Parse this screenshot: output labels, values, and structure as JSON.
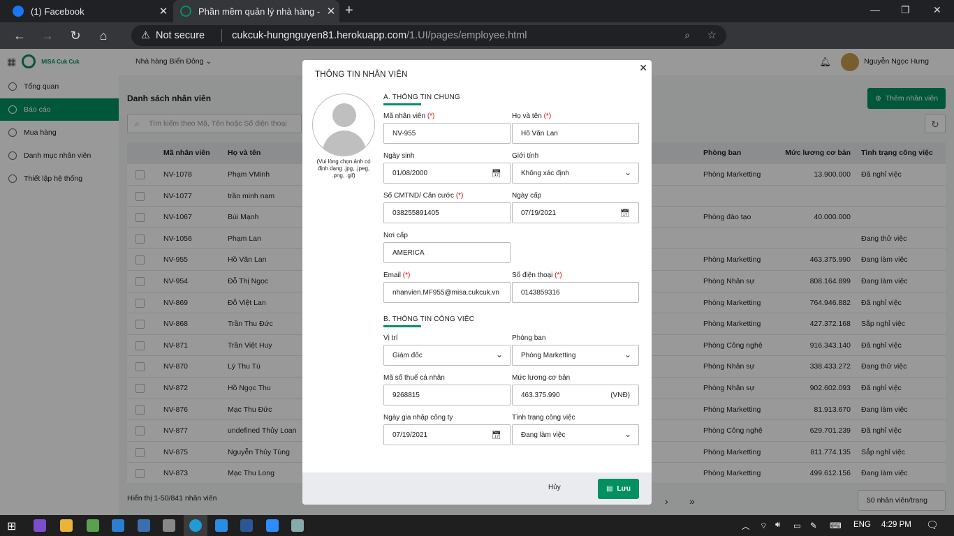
{
  "browser": {
    "tabs": [
      {
        "title": "(1) Facebook",
        "color": "#1877f2"
      },
      {
        "title": "Phần mềm quản lý nhà hàng - C",
        "color": "#019160"
      }
    ],
    "security": "Not secure",
    "url_host": "cukcuk-hungnguyen81.herokuapp.com",
    "url_path": "/1.UI/pages/employee.html"
  },
  "sidebar": {
    "logo_text": "MISA Cuk Cuk",
    "items": [
      {
        "label": "Tổng quan"
      },
      {
        "label": "Báo cáo"
      },
      {
        "label": "Mua hàng"
      },
      {
        "label": "Danh mục nhân viên"
      },
      {
        "label": "Thiết lập hệ thống"
      }
    ]
  },
  "header": {
    "store": "Nhà hàng Biển Đông",
    "user": "Nguyễn Ngọc Hưng"
  },
  "page": {
    "title": "Danh sách nhân viên",
    "add_button": "Thêm nhân viên",
    "search_placeholder": "Tìm kiếm theo Mã, Tên hoặc Số điện thoại"
  },
  "table": {
    "headers": {
      "code": "Mã nhân viên",
      "name": "Họ và tên",
      "dept": "Phòng ban",
      "salary": "Mức lương cơ bản",
      "status": "Tình trạng công việc"
    },
    "rows": [
      {
        "code": "NV-1078",
        "name": "Phạm VMinh",
        "dept": "Phòng Marketting",
        "salary": "13.900.000",
        "status": "Đã nghỉ việc"
      },
      {
        "code": "NV-1077",
        "name": "trần minh nam",
        "dept": "",
        "salary": "",
        "status": ""
      },
      {
        "code": "NV-1067",
        "name": "Bùi Mạnh",
        "dept": "Phòng đào tạo",
        "salary": "40.000.000",
        "status": ""
      },
      {
        "code": "NV-1056",
        "name": "Phạm Lan",
        "dept": "",
        "salary": "",
        "status": "Đang thử việc"
      },
      {
        "code": "NV-955",
        "name": "Hồ Văn Lan",
        "dept": "Phòng Marketting",
        "salary": "463.375.990",
        "status": "Đang làm việc"
      },
      {
        "code": "NV-954",
        "name": "Đỗ Thị Ngọc",
        "dept": "Phòng Nhân sự",
        "salary": "808.164.899",
        "status": "Đang làm việc"
      },
      {
        "code": "NV-869",
        "name": "Đỗ Việt Lan",
        "dept": "Phòng Marketting",
        "salary": "764.946.882",
        "status": "Đã nghỉ việc"
      },
      {
        "code": "NV-868",
        "name": "Trần Thu Đức",
        "dept": "Phòng Marketting",
        "salary": "427.372.168",
        "status": "Sắp nghỉ việc"
      },
      {
        "code": "NV-871",
        "name": "Trần Việt Huy",
        "dept": "Phòng Công nghệ",
        "salary": "916.343.140",
        "status": "Đã nghỉ việc"
      },
      {
        "code": "NV-870",
        "name": "Lý Thu Tú",
        "dept": "Phòng Nhân sự",
        "salary": "338.433.272",
        "status": "Đang thử việc"
      },
      {
        "code": "NV-872",
        "name": "Hồ Ngọc Thu",
        "dept": "Phòng Nhân sự",
        "salary": "902.602.093",
        "status": "Đã nghỉ việc"
      },
      {
        "code": "NV-876",
        "name": "Mạc Thu Đức",
        "dept": "Phòng Marketting",
        "salary": "81.913.670",
        "status": "Đang làm việc"
      },
      {
        "code": "NV-877",
        "name": "undefined Thủy Loan",
        "dept": "Phòng Công nghệ",
        "salary": "629.701.239",
        "status": "Đã nghỉ việc"
      },
      {
        "code": "NV-875",
        "name": "Nguyễn Thủy Tùng",
        "dept": "Phòng Marketting",
        "salary": "811.774.135",
        "status": "Sắp nghỉ việc"
      },
      {
        "code": "NV-873",
        "name": "Mạc Thu Long",
        "dept": "Phòng Marketting",
        "salary": "499.612.156",
        "status": "Đang làm việc"
      }
    ]
  },
  "footer": {
    "summary": "Hiển thị 1-50/841 nhân viên",
    "page_size": "50 nhân viên/trang"
  },
  "modal": {
    "title": "THÔNG TIN NHÂN VIÊN",
    "avatar_note": "(Vui lòng chọn ảnh có định dạng .jpg, .jpeg, .png, .gif)",
    "section_a": "A. THÔNG TIN CHUNG",
    "section_b": "B. THÔNG TIN CÔNG VIỆC",
    "required_mark": "(*)",
    "fields": {
      "code": {
        "label": "Mã nhân viên",
        "value": "NV-955"
      },
      "fullname": {
        "label": "Họ và tên",
        "value": "Hồ Văn Lan"
      },
      "dob": {
        "label": "Ngày sinh",
        "value": "01/08/2000"
      },
      "gender": {
        "label": "Giới tính",
        "value": "Không xác định"
      },
      "idnum": {
        "label": "Số CMTND/ Căn cước",
        "value": "038255891405"
      },
      "issue_date": {
        "label": "Ngày cấp",
        "value": "07/19/2021"
      },
      "issue_place": {
        "label": "Nơi cấp",
        "value": "AMERICA"
      },
      "email": {
        "label": "Email",
        "value": "nhanvien.MF955@misa.cukcuk.vn"
      },
      "phone": {
        "label": "Số điện thoại",
        "value": "0143859316"
      },
      "position": {
        "label": "Vị trí",
        "value": "Giám đốc"
      },
      "department": {
        "label": "Phòng ban",
        "value": "Phòng Marketting"
      },
      "tax": {
        "label": "Mã số thuế cá nhân",
        "value": "9268815"
      },
      "salary": {
        "label": "Mức lương cơ bản",
        "value": "463.375.990",
        "unit": "(VNĐ)"
      },
      "join_date": {
        "label": "Ngày gia nhập công ty",
        "value": "07/19/2021"
      },
      "work_status": {
        "label": "Tình trạng công việc",
        "value": "Đang làm việc"
      }
    },
    "cancel": "Hủy",
    "save": "Lưu"
  },
  "taskbar": {
    "lang": "ENG",
    "time": "4:29 PM"
  },
  "colors": {
    "accent": "#019160",
    "required": "#e00000"
  }
}
